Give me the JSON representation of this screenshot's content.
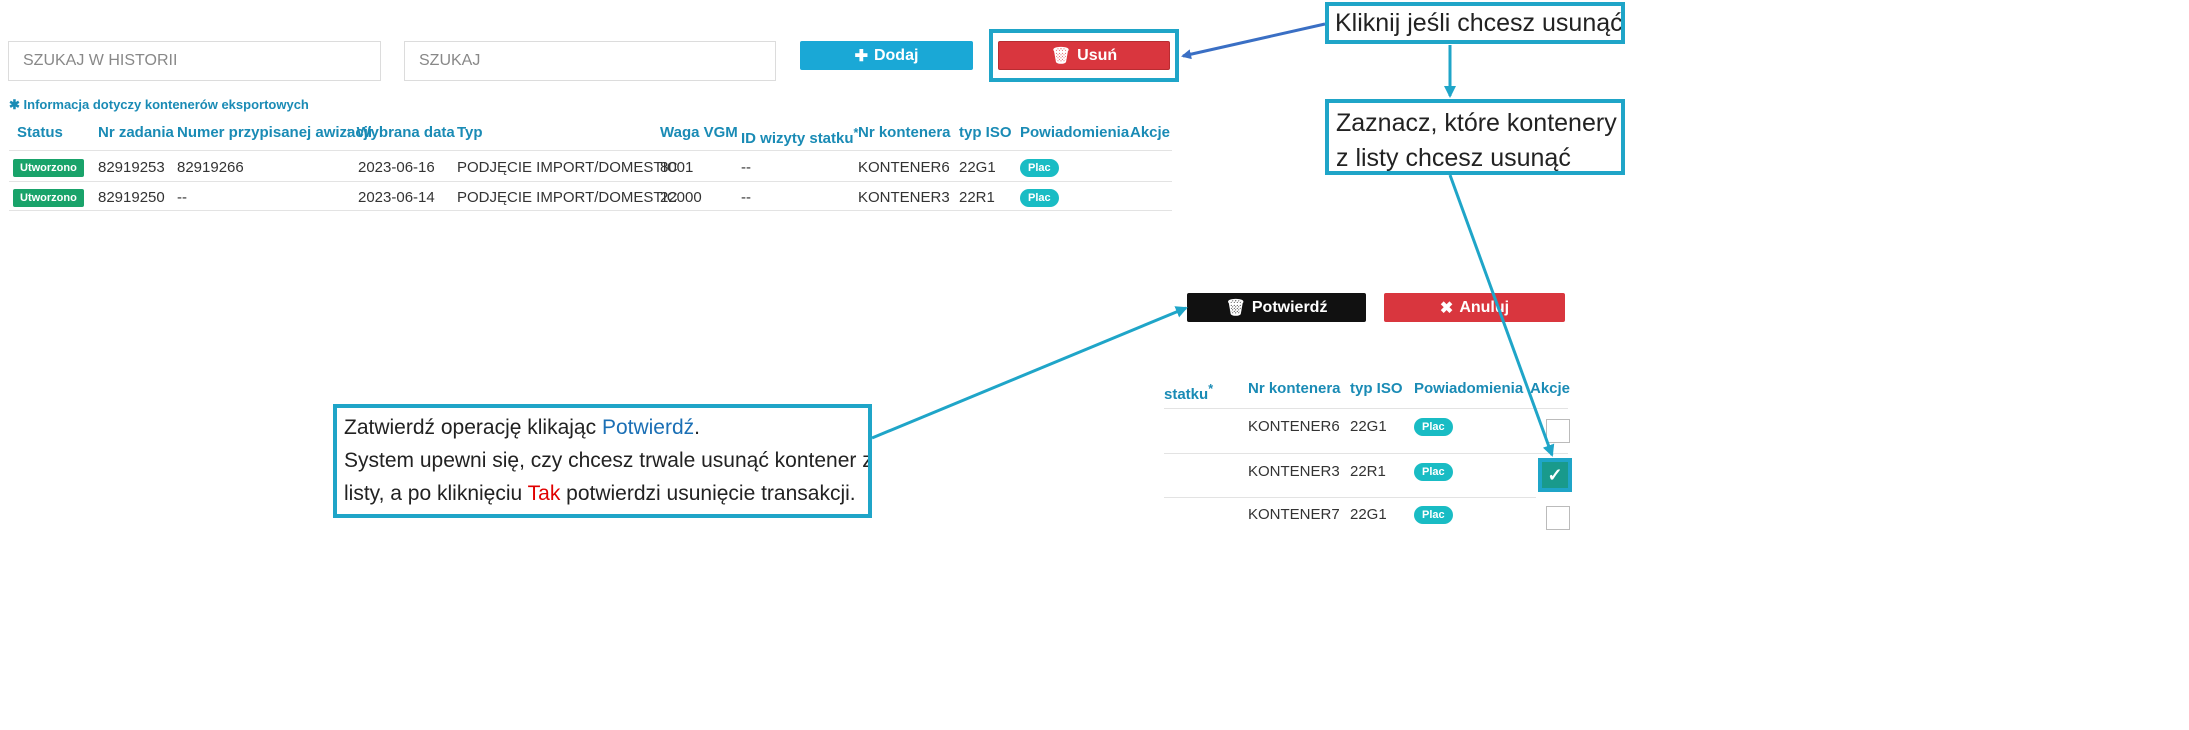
{
  "search": {
    "history_placeholder": "SZUKAJ W HISTORII",
    "search_placeholder": "SZUKAJ"
  },
  "toolbar": {
    "add_label": "Dodaj",
    "delete_label": "Usuń",
    "confirm_label": "Potwierdź",
    "cancel_label": "Anuluj"
  },
  "info_note": "Informacja dotyczy kontenerów eksportowych",
  "table": {
    "columns": [
      "Status",
      "Nr zadania",
      "Numer przypisanej awizacji",
      "Wybrana data",
      "Typ",
      "Waga VGM",
      "ID wizyty statku",
      "Nr kontenera",
      "typ ISO",
      "Powiadomienia",
      "Akcje"
    ],
    "asterisk": "*",
    "rows": [
      {
        "status": "Utworzono",
        "task": "82919253",
        "awizacja": "82919266",
        "date": "2023-06-16",
        "type": "PODJĘCIE IMPORT/DOMESTIC",
        "vgm": "8001",
        "visit": "--",
        "container": "KONTENER6",
        "iso": "22G1",
        "notif": "Plac"
      },
      {
        "status": "Utworzono",
        "task": "82919250",
        "awizacja": "--",
        "date": "2023-06-14",
        "type": "PODJĘCIE IMPORT/DOMESTIC",
        "vgm": "22000",
        "visit": "--",
        "container": "KONTENER3",
        "iso": "22R1",
        "notif": "Plac"
      }
    ]
  },
  "zoom_table": {
    "columns": [
      "statku",
      "Nr kontenera",
      "typ ISO",
      "Powiadomienia",
      "Akcje"
    ],
    "asterisk": "*",
    "rows": [
      {
        "container": "KONTENER6",
        "iso": "22G1",
        "notif": "Plac",
        "checked": false
      },
      {
        "container": "KONTENER3",
        "iso": "22R1",
        "notif": "Plac",
        "checked": true
      },
      {
        "container": "KONTENER7",
        "iso": "22G1",
        "notif": "Plac",
        "checked": false
      }
    ]
  },
  "callouts": {
    "delete_hint": "Kliknij jeśli chcesz usunąć",
    "select_hint_line1": "Zaznacz, które kontenery",
    "select_hint_line2": "z listy chcesz usunąć",
    "confirm_hint_pre": "Zatwierdź operację klikając ",
    "confirm_hint_link": "Potwierdź",
    "confirm_hint_end": ".",
    "confirm_hint_line2": "System upewni się, czy chcesz trwale usunąć kontener z",
    "confirm_hint_line3_pre": "listy, a po kliknięciu ",
    "confirm_hint_tak": "Tak",
    "confirm_hint_line3_post": " potwierdzi usunięcie transakcji."
  },
  "colors": {
    "accent": "#1aa8d6",
    "delete": "#d9363e",
    "highlight": "#1fa5c8",
    "status": "#19a36a",
    "badge": "#19bcc4"
  }
}
